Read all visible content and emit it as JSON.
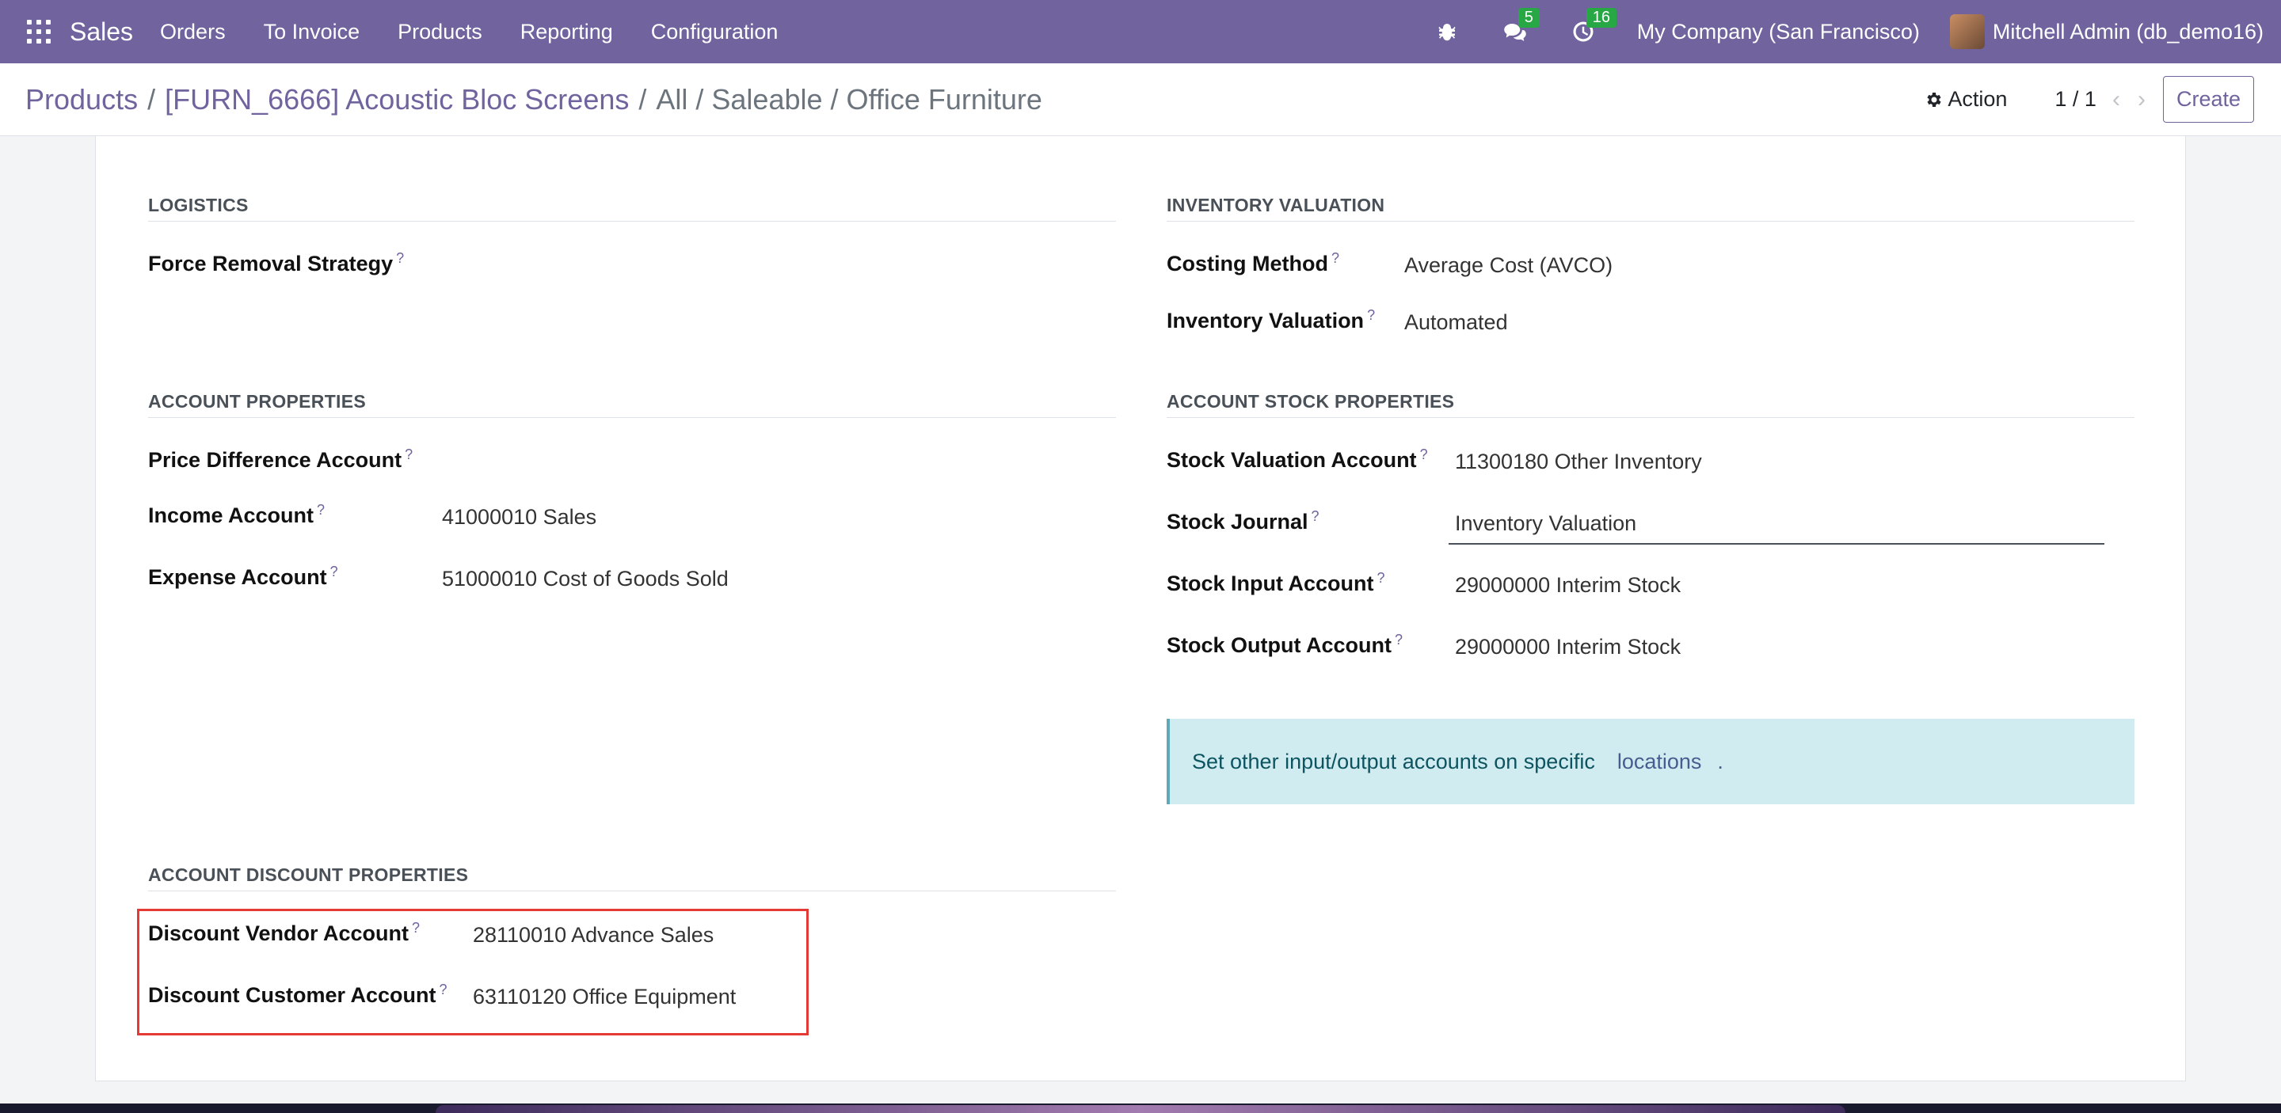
{
  "navbar": {
    "app_name": "Sales",
    "menus": [
      "Orders",
      "To Invoice",
      "Products",
      "Reporting",
      "Configuration"
    ],
    "chat_count": "5",
    "activity_count": "16",
    "company": "My Company (San Francisco)",
    "user": "Mitchell Admin (db_demo16)"
  },
  "control_panel": {
    "breadcrumb_products": "Products",
    "breadcrumb_record": "[FURN_6666] Acoustic Bloc Screens",
    "breadcrumb_category": "All / Saleable / Office Furniture",
    "action_label": "Action",
    "pager": "1 / 1",
    "create_label": "Create"
  },
  "logistics": {
    "title": "LOGISTICS",
    "force_removal_label": "Force Removal Strategy"
  },
  "inventory_valuation": {
    "title": "INVENTORY VALUATION",
    "costing_method_label": "Costing Method",
    "costing_method_value": "Average Cost (AVCO)",
    "valuation_label": "Inventory Valuation",
    "valuation_value": "Automated"
  },
  "account_properties": {
    "title": "ACCOUNT PROPERTIES",
    "price_diff_label": "Price Difference Account",
    "income_label": "Income Account",
    "income_value": "41000010 Sales",
    "expense_label": "Expense Account",
    "expense_value": "51000010 Cost of Goods Sold"
  },
  "account_stock_properties": {
    "title": "ACCOUNT STOCK PROPERTIES",
    "valuation_account_label": "Stock Valuation Account",
    "valuation_account_value": "11300180 Other Inventory",
    "journal_label": "Stock Journal",
    "journal_value": "Inventory Valuation",
    "input_label": "Stock Input Account",
    "input_value": "29000000 Interim Stock",
    "output_label": "Stock Output Account",
    "output_value": "29000000 Interim Stock",
    "alert_text": "Set other input/output accounts on specific",
    "alert_link": "locations",
    "alert_end": "."
  },
  "account_discount_properties": {
    "title": "ACCOUNT DISCOUNT PROPERTIES",
    "vendor_label": "Discount Vendor Account",
    "vendor_value": "28110010 Advance Sales",
    "customer_label": "Discount Customer Account",
    "customer_value": "63110120 Office Equipment"
  },
  "help_marker": "?",
  "colors": {
    "brand": "#71639e",
    "highlight": "#e53935",
    "alert_bg": "#d1ecf1"
  }
}
